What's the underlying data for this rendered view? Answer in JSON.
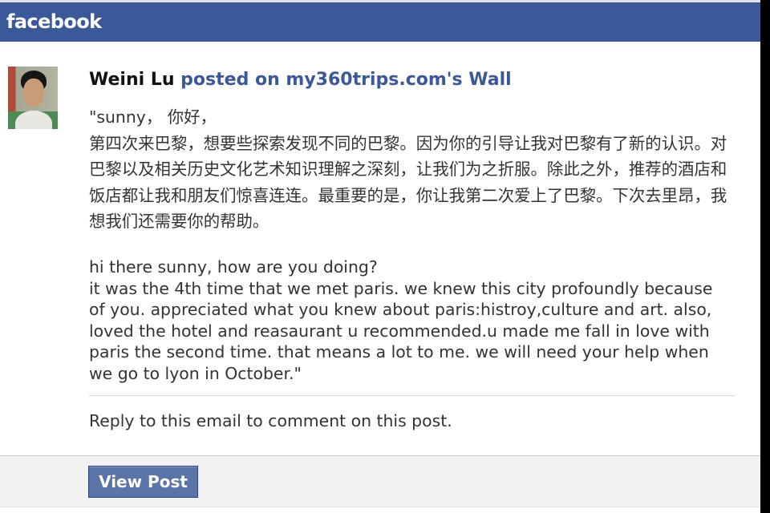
{
  "header": {
    "brand": "facebook"
  },
  "post": {
    "author": "Weini Lu",
    "action": "posted on my360trips.com's Wall",
    "message_zh_lines": [
      "\"sunny， 你好，",
      "第四次来巴黎，想要些探索发现不同的巴黎。因为你的引导让我对巴黎有了新的认识。对",
      "巴黎以及相关历史文化艺术知识理解之深刻，让我们为之折服。除此之外，推荐的酒店和",
      "饭店都让我和朋友们惊喜连连。最重要的是，你让我第二次爱上了巴黎。下次去里昂，我",
      "想我们还需要你的帮助。"
    ],
    "message_en_lines": [
      "hi there sunny, how are you doing?",
      "it was the 4th time that we met paris. we knew this city profoundly because",
      "of you. appreciated what you knew about paris:histroy,culture and art. also,",
      "loved the hotel and reasaurant u recommended.u made me fall in love with",
      "paris the second time. that means a lot to me. we will need your help when",
      "we go to lyon in October.\""
    ],
    "reply_note": "Reply to this email to comment on this post."
  },
  "footer": {
    "view_post_label": "View Post"
  },
  "colors": {
    "brand_blue": "#3b5998",
    "button_blue": "#5b74a8",
    "text": "#333333"
  }
}
